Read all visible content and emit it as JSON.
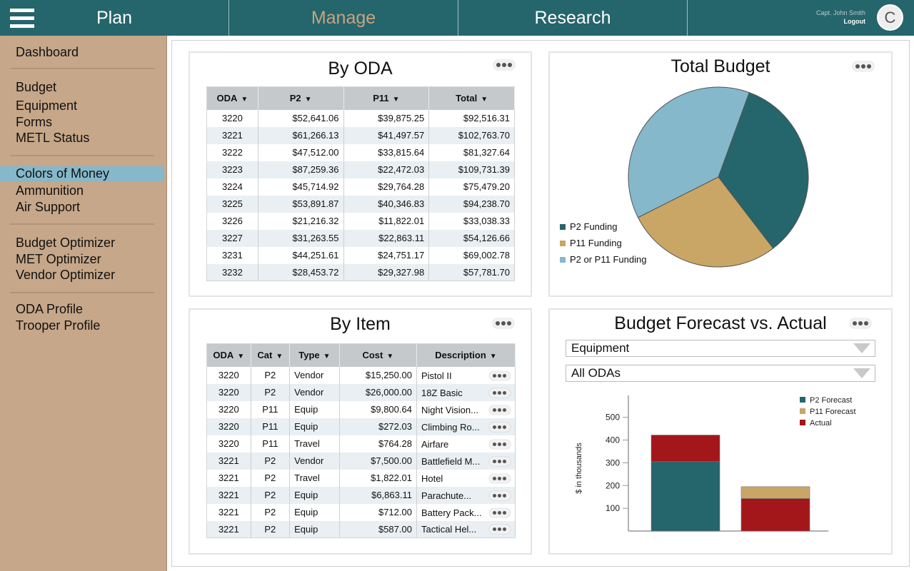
{
  "nav": {
    "tabs": [
      {
        "label": "Plan"
      },
      {
        "label": "Manage"
      },
      {
        "label": "Research"
      }
    ],
    "user_name": "Capt. John Smith",
    "logout": "Logout",
    "avatar_initial": "C",
    "menu_icon": "hamburger-menu-icon"
  },
  "sidebar": {
    "items": [
      {
        "label": "Dashboard"
      },
      {
        "label": "Budget"
      },
      {
        "label": "Equipment"
      },
      {
        "label": "Forms"
      },
      {
        "label": "METL Status"
      },
      {
        "label": "Colors of Money"
      },
      {
        "label": "Ammunition"
      },
      {
        "label": "Air Support"
      },
      {
        "label": "Budget Optimizer"
      },
      {
        "label": "MET Optimizer"
      },
      {
        "label": "Vendor Optimizer"
      },
      {
        "label": "ODA Profile"
      },
      {
        "label": "Trooper Profile"
      }
    ],
    "active": "Colors of Money"
  },
  "by_oda": {
    "title": "By ODA",
    "headers": [
      "ODA",
      "P2",
      "P11",
      "Total"
    ],
    "rows": [
      [
        "3220",
        "$52,641.06",
        "$39,875.25",
        "$92,516.31"
      ],
      [
        "3221",
        "$61,266.13",
        "$41,497.57",
        "$102,763.70"
      ],
      [
        "3222",
        "$47,512.00",
        "$33,815.64",
        "$81,327.64"
      ],
      [
        "3223",
        "$87,259.36",
        "$22,472.03",
        "$109,731.39"
      ],
      [
        "3224",
        "$45,714.92",
        "$29,764.28",
        "$75,479.20"
      ],
      [
        "3225",
        "$53,891.87",
        "$40,346.83",
        "$94,238.70"
      ],
      [
        "3226",
        "$21,216.32",
        "$11,822.01",
        "$33,038.33"
      ],
      [
        "3227",
        "$31,263.55",
        "$22,863.11",
        "$54,126.66"
      ],
      [
        "3231",
        "$44,251.61",
        "$24,751.17",
        "$69,002.78"
      ],
      [
        "3232",
        "$28,453.72",
        "$29,327.98",
        "$57,781.70"
      ]
    ]
  },
  "by_item": {
    "title": "By Item",
    "headers": [
      "ODA",
      "Cat",
      "Type",
      "Cost",
      "Description"
    ],
    "rows": [
      [
        "3220",
        "P2",
        "Vendor",
        "$15,250.00",
        "Pistol II"
      ],
      [
        "3220",
        "P2",
        "Vendor",
        "$26,000.00",
        "18Z Basic"
      ],
      [
        "3220",
        "P11",
        "Equip",
        "$9,800.64",
        "Night Vision..."
      ],
      [
        "3220",
        "P11",
        "Equip",
        "$272.03",
        "Climbing Ro..."
      ],
      [
        "3220",
        "P11",
        "Travel",
        "$764.28",
        "Airfare"
      ],
      [
        "3221",
        "P2",
        "Vendor",
        "$7,500.00",
        "Battlefield M..."
      ],
      [
        "3221",
        "P2",
        "Travel",
        "$1,822.01",
        "Hotel"
      ],
      [
        "3221",
        "P2",
        "Equip",
        "$6,863.11",
        "Parachute..."
      ],
      [
        "3221",
        "P2",
        "Equip",
        "$712.00",
        "Battery Pack..."
      ],
      [
        "3221",
        "P2",
        "Equip",
        "$587.00",
        "Tactical Hel..."
      ]
    ]
  },
  "total_budget": {
    "title": "Total Budget",
    "chart_data": {
      "type": "pie",
      "slices": [
        {
          "name": "P2 Funding",
          "value": 34,
          "color": "#25656c"
        },
        {
          "name": "P11 Funding",
          "value": 28,
          "color": "#c9a665"
        },
        {
          "name": "P2 or P11 Funding",
          "value": 38,
          "color": "#85b8cb"
        }
      ],
      "legend_position": "left"
    }
  },
  "forecast": {
    "title": "Budget Forecast vs. Actual",
    "category_filter": "Equipment",
    "oda_filter": "All ODAs",
    "chart_data": {
      "type": "bar",
      "stacked": true,
      "ylabel": "$ in thousands",
      "yticks": [
        100,
        200,
        300,
        400,
        500
      ],
      "ylim": [
        0,
        590
      ],
      "bars": [
        {
          "segments": [
            {
              "series": "P2 Forecast",
              "value": 305,
              "color": "#25656c"
            },
            {
              "series": "Actual",
              "value": 117,
              "color": "#a3161a"
            }
          ]
        },
        {
          "segments": [
            {
              "series": "Actual",
              "value": 143,
              "color": "#a3161a"
            },
            {
              "series": "P11 Forecast",
              "value": 52,
              "color": "#c9a665"
            }
          ]
        }
      ],
      "legend": [
        {
          "name": "P2 Forecast",
          "color": "#25656c"
        },
        {
          "name": "P11 Forecast",
          "color": "#c9a665"
        },
        {
          "name": "Actual",
          "color": "#a3161a"
        }
      ],
      "legend_position": "top-right"
    }
  }
}
